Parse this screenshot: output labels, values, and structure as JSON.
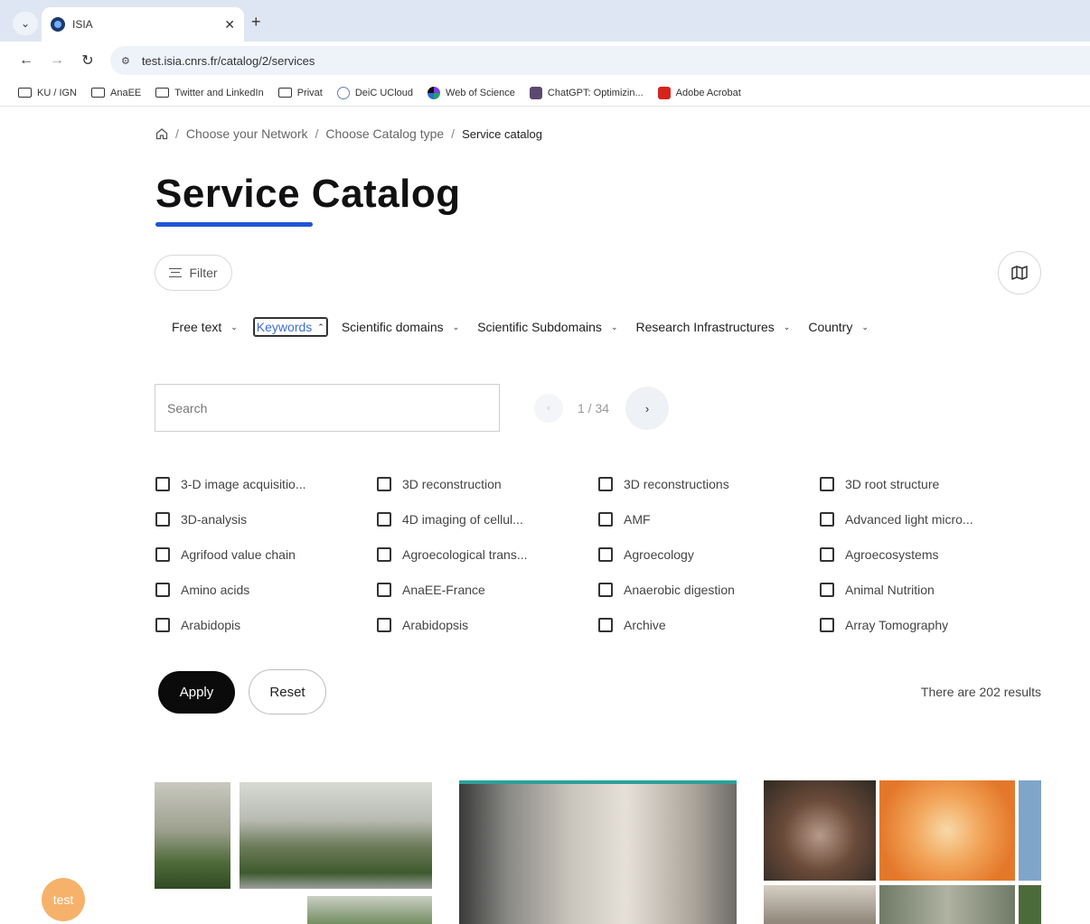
{
  "browser": {
    "tab": {
      "title": "ISIA"
    },
    "address": {
      "url": "test.isia.cnrs.fr/catalog/2/services"
    },
    "bookmarks": [
      {
        "label": "KU / IGN",
        "type": "folder"
      },
      {
        "label": "AnaEE",
        "type": "folder"
      },
      {
        "label": "Twitter and LinkedIn",
        "type": "folder"
      },
      {
        "label": "Privat",
        "type": "folder"
      },
      {
        "label": "DeiC UCloud",
        "type": "site"
      },
      {
        "label": "Web of Science",
        "type": "site"
      },
      {
        "label": "ChatGPT: Optimizin...",
        "type": "site"
      },
      {
        "label": "Adobe Acrobat",
        "type": "site"
      }
    ]
  },
  "breadcrumb": {
    "items": [
      "Choose your Network",
      "Choose Catalog type"
    ],
    "current": "Service catalog"
  },
  "page": {
    "title": "Service Catalog",
    "filter_label": "Filter"
  },
  "filter_tabs": [
    {
      "label": "Free text",
      "active": false
    },
    {
      "label": "Keywords",
      "active": true
    },
    {
      "label": "Scientific domains",
      "active": false
    },
    {
      "label": "Scientific Subdomains",
      "active": false
    },
    {
      "label": "Research Infrastructures",
      "active": false
    },
    {
      "label": "Country",
      "active": false
    }
  ],
  "search": {
    "placeholder": "Search",
    "value": ""
  },
  "pager": {
    "text": "1 / 34"
  },
  "keywords": [
    "3-D image acquisitio...",
    "3D reconstruction",
    "3D reconstructions",
    "3D root structure",
    "3D-analysis",
    "4D imaging of cellul...",
    "AMF",
    "Advanced light micro...",
    "Agrifood value chain",
    "Agroecological trans...",
    "Agroecology",
    "Agroecosystems",
    "Amino acids",
    "AnaEE-France",
    "Anaerobic digestion",
    "Animal Nutrition",
    "Arabidopis",
    "Arabidopsis",
    "Archive",
    "Array Tomography"
  ],
  "actions": {
    "apply": "Apply",
    "reset": "Reset"
  },
  "results_text": "There are 202 results",
  "chat": {
    "label": "test"
  },
  "colors": {
    "accent": "#1f55d6",
    "apply_bg": "#0b0b0b",
    "chat": "#f6b26b",
    "card_top": "#2aa39a"
  }
}
